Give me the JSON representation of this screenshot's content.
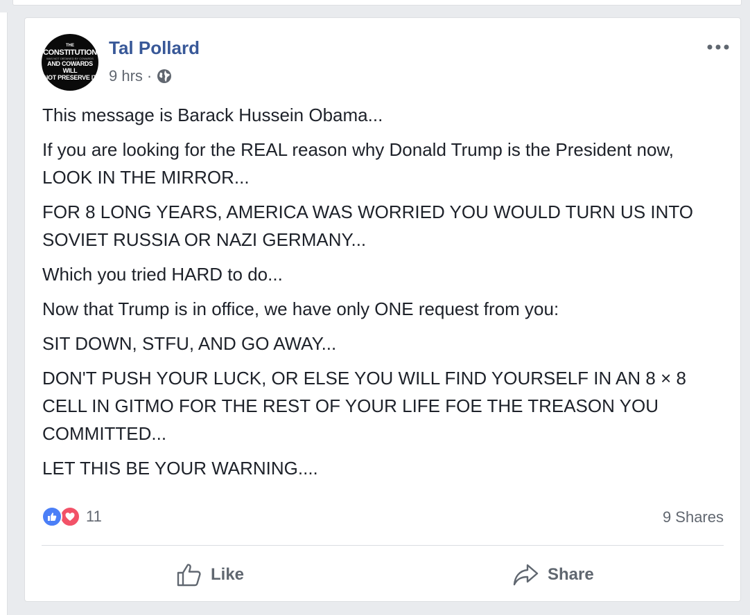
{
  "post": {
    "author": "Tal Pollard",
    "timestamp": "9 hrs",
    "separator": "·",
    "privacy_icon": "globe-icon",
    "avatar_text": {
      "line1": "THE",
      "line2": "CONSTITUTION",
      "line3": "WAS NOT OBTAINED BY COWARDS",
      "line4": "AND COWARDS WILL",
      "line5": "NOT PRESERVE IT"
    },
    "paragraphs": [
      "This message is Barack Hussein Obama...",
      "If you are looking for the REAL reason why Donald Trump is the President now, LOOK IN THE MIRROR...",
      "FOR 8 LONG YEARS, AMERICA WAS WORRIED YOU WOULD TURN US INTO SOVIET RUSSIA OR NAZI GERMANY...",
      "Which you tried HARD to do...",
      "Now that Trump is in office, we have only ONE request from you:",
      "SIT DOWN, STFU, AND GO AWAY...",
      "DON'T PUSH YOUR LUCK, OR ELSE YOU WILL FIND YOURSELF IN AN 8 × 8 CELL IN GITMO FOR THE REST OF YOUR LIFE FOE THE TREASON YOU COMMITTED...",
      "LET THIS BE YOUR WARNING...."
    ]
  },
  "stats": {
    "reaction_count": "11",
    "reaction_icons": [
      "like-reaction-icon",
      "love-reaction-icon"
    ],
    "shares": "9 Shares"
  },
  "actions": {
    "like_label": "Like",
    "share_label": "Share"
  },
  "colors": {
    "author_link": "#385898",
    "meta_text": "#616770",
    "like_blue": "#4b7ff7",
    "love_red": "#f25268",
    "page_bg": "#e9ebee"
  }
}
